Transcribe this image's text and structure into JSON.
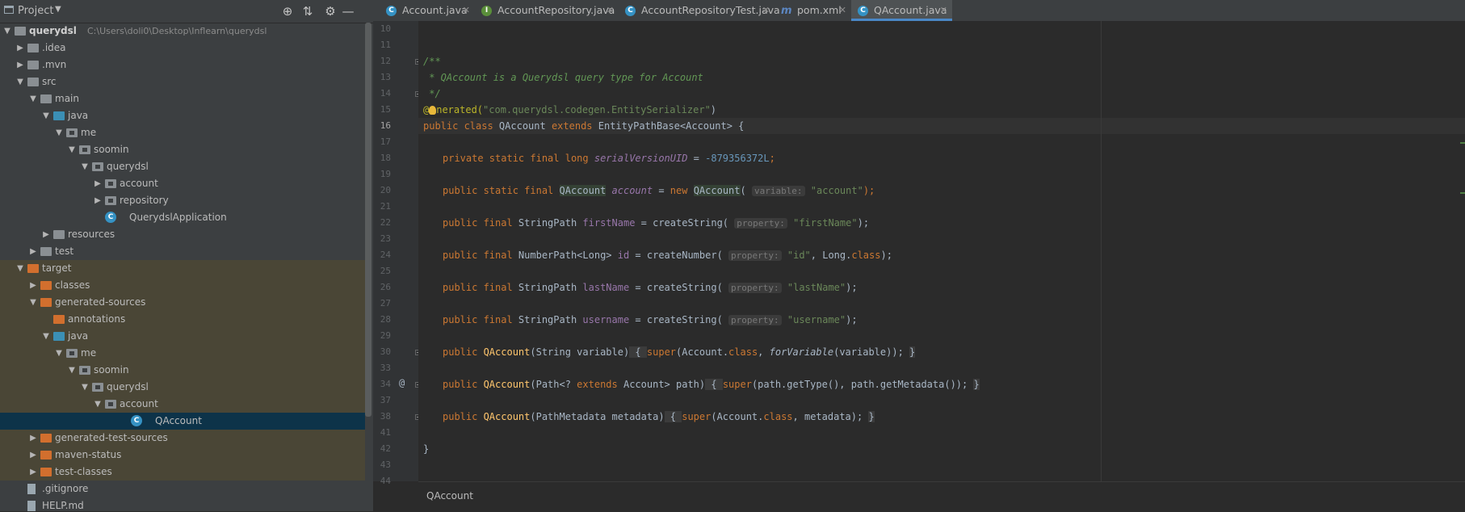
{
  "project_panel": {
    "title": "Project",
    "tree": [
      {
        "label": "querydsl",
        "path": "C:\\Users\\doli0\\Desktop\\Inflearn\\querydsl",
        "icon": "module-folder-icon",
        "expanded": true,
        "depth": 0,
        "bold": true
      },
      {
        "label": ".idea",
        "icon": "folder-icon",
        "expanded": false,
        "depth": 1
      },
      {
        "label": ".mvn",
        "icon": "folder-icon",
        "expanded": false,
        "depth": 1
      },
      {
        "label": "src",
        "icon": "folder-icon",
        "expanded": true,
        "depth": 1
      },
      {
        "label": "main",
        "icon": "folder-icon",
        "expanded": true,
        "depth": 2
      },
      {
        "label": "java",
        "icon": "source-folder-icon",
        "expanded": true,
        "depth": 3
      },
      {
        "label": "me",
        "icon": "package-icon",
        "expanded": true,
        "depth": 4
      },
      {
        "label": "soomin",
        "icon": "package-icon",
        "expanded": true,
        "depth": 5
      },
      {
        "label": "querydsl",
        "icon": "package-icon",
        "expanded": true,
        "depth": 6
      },
      {
        "label": "account",
        "icon": "package-icon",
        "expanded": false,
        "depth": 7
      },
      {
        "label": "repository",
        "icon": "package-icon",
        "expanded": false,
        "depth": 7
      },
      {
        "label": "QuerydslApplication",
        "icon": "spring-class-icon",
        "depth": 7
      },
      {
        "label": "resources",
        "icon": "resources-folder-icon",
        "expanded": false,
        "depth": 3
      },
      {
        "label": "test",
        "icon": "folder-icon",
        "expanded": false,
        "depth": 2
      },
      {
        "label": "target",
        "icon": "excluded-folder-icon",
        "expanded": true,
        "depth": 1,
        "excluded": true
      },
      {
        "label": "classes",
        "icon": "excluded-folder-icon",
        "expanded": false,
        "depth": 2,
        "excluded": true
      },
      {
        "label": "generated-sources",
        "icon": "excluded-folder-icon",
        "expanded": true,
        "depth": 2,
        "excluded": true
      },
      {
        "label": "annotations",
        "icon": "excluded-folder-icon",
        "depth": 3,
        "excluded": true
      },
      {
        "label": "java",
        "icon": "generated-source-folder-icon",
        "expanded": true,
        "depth": 3,
        "excluded": true
      },
      {
        "label": "me",
        "icon": "package-icon",
        "expanded": true,
        "depth": 4,
        "excluded": true
      },
      {
        "label": "soomin",
        "icon": "package-icon",
        "expanded": true,
        "depth": 5,
        "excluded": true
      },
      {
        "label": "querydsl",
        "icon": "package-icon",
        "expanded": true,
        "depth": 6,
        "excluded": true
      },
      {
        "label": "account",
        "icon": "package-icon",
        "expanded": true,
        "depth": 7,
        "excluded": true
      },
      {
        "label": "QAccount",
        "icon": "class-icon",
        "depth": 9,
        "excluded": true,
        "selected": true
      },
      {
        "label": "generated-test-sources",
        "icon": "excluded-folder-icon",
        "expanded": false,
        "depth": 2,
        "excluded": true
      },
      {
        "label": "maven-status",
        "icon": "excluded-folder-icon",
        "expanded": false,
        "depth": 2,
        "excluded": true
      },
      {
        "label": "test-classes",
        "icon": "excluded-folder-icon",
        "expanded": false,
        "depth": 2,
        "excluded": true
      },
      {
        "label": ".gitignore",
        "icon": "file-icon",
        "depth": 1
      },
      {
        "label": "HELP.md",
        "icon": "file-icon",
        "depth": 1
      }
    ]
  },
  "tabs": [
    {
      "label": "Account.java",
      "icon": "C",
      "icon_color": "#3592c4"
    },
    {
      "label": "AccountRepository.java",
      "icon": "I",
      "icon_color": "#5a8f3a"
    },
    {
      "label": "AccountRepositoryTest.java",
      "icon": "C",
      "icon_color": "#3592c4"
    },
    {
      "label": "pom.xml",
      "icon": "m",
      "icon_color": "#3c3f41"
    },
    {
      "label": "QAccount.java",
      "icon": "C",
      "icon_color": "#3592c4",
      "active": true
    }
  ],
  "editor": {
    "line_numbers": [
      "10",
      "11",
      "12",
      "13",
      "14",
      "15",
      "16",
      "17",
      "18",
      "19",
      "20",
      "21",
      "22",
      "23",
      "24",
      "25",
      "26",
      "27",
      "28",
      "29",
      "30",
      "33",
      "34",
      "37",
      "38",
      "41",
      "42",
      "43",
      "44"
    ],
    "current_line": "16",
    "code": {
      "l12": "/**",
      "l13": " * QAccount is a Querydsl query type for Account",
      "l14": " */",
      "l15_at": "@",
      "l15_ann": "nerated(",
      "l15_str": "\"com.querydsl.codegen.EntitySerializer\"",
      "l15_end": ")",
      "l16_kw": "public class ",
      "l16_name": "QAccount",
      "l16_ext": " extends ",
      "l16_rest": "EntityPathBase<Account> {",
      "l18_kw": "private static final long ",
      "l18_fld": "serialVersionUID",
      "l18_eq": " = ",
      "l18_num": "-879356372L",
      "l18_end": ";",
      "l20_kw": "public static final ",
      "l20_type": "QAccount",
      "l20_fld": "account",
      "l20_eq": " = ",
      "l20_new": "new ",
      "l20_ctor": "QAccount",
      "l20_hint": "variable:",
      "l20_str": "\"account\"",
      "l20_end": ");",
      "l22_kw": "public final ",
      "l22_type": "StringPath ",
      "l22_fld": "firstName",
      "l22_call": " = createString(",
      "l22_hint": "property:",
      "l22_str": "\"firstName\"",
      "l22_end": ");",
      "l24_kw": "public final ",
      "l24_type": "NumberPath<Long> ",
      "l24_fld": "id",
      "l24_call": " = createNumber(",
      "l24_hint": "property:",
      "l24_str": "\"id\"",
      "l24_mid": ", Long.",
      "l24_cls": "class",
      "l24_end": ");",
      "l26_kw": "public final ",
      "l26_type": "StringPath ",
      "l26_fld": "lastName",
      "l26_call": " = createString(",
      "l26_hint": "property:",
      "l26_str": "\"lastName\"",
      "l26_end": ");",
      "l28_kw": "public final ",
      "l28_type": "StringPath ",
      "l28_fld": "username",
      "l28_call": " = createString(",
      "l28_hint": "property:",
      "l28_str": "\"username\"",
      "l28_end": ");",
      "l30_kw": "public ",
      "l30_name": "QAccount",
      "l30_params": "(String variable)",
      "l30_open": " { ",
      "l30_super": "super",
      "l30_a": "(Account.",
      "l30_cls": "class",
      "l30_b": ", ",
      "l30_fv": "forVariable",
      "l30_c": "(variable)); ",
      "l30_close": "}",
      "l34_kw": "public ",
      "l34_name": "QAccount",
      "l34_p1": "(Path<? ",
      "l34_ext": "extends",
      "l34_p2": " Account> path)",
      "l34_open": " { ",
      "l34_super": "super",
      "l34_body": "(path.getType(), path.getMetadata()); ",
      "l34_close": "}",
      "l38_kw": "public ",
      "l38_name": "QAccount",
      "l38_params": "(PathMetadata metadata)",
      "l38_open": " { ",
      "l38_super": "super",
      "l38_a": "(Account.",
      "l38_cls": "class",
      "l38_b": ", metadata); ",
      "l38_close": "}",
      "l42": "}"
    },
    "gutter_at_line": "34",
    "gutter_at": "@"
  },
  "breadcrumb": "QAccount"
}
